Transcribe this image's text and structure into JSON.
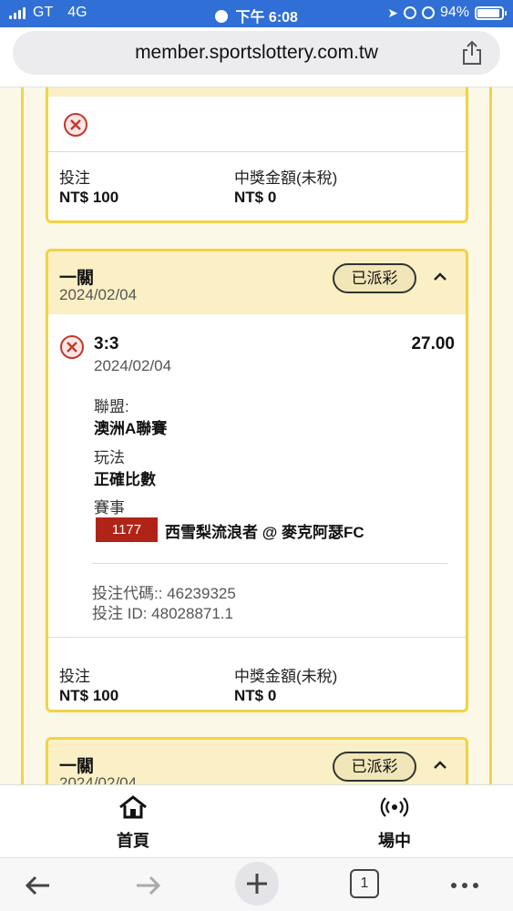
{
  "status_bar": {
    "carrier": "GT",
    "network": "4G",
    "time": "下午 6:08",
    "battery": "94%",
    "battery_level": 0.94
  },
  "browser": {
    "url": "member.sportslottery.com.tw",
    "tab_count": "1"
  },
  "bets": [
    {
      "stake_label": "投注",
      "stake_value": "NT$ 100",
      "payout_label": "中獎金額(未稅)",
      "payout_value": "NT$ 0"
    },
    {
      "type": "一關",
      "date": "2024/02/04",
      "status": "已派彩",
      "selection": {
        "score": "3:3",
        "odds": "27.00",
        "date": "2024/02/04",
        "league_label": "聯盟:",
        "league": "澳洲A聯賽",
        "market_label": "玩法",
        "market": "正確比數",
        "event_label": "賽事",
        "match_code": "1177",
        "match": "西雪梨流浪者 @ 麥克阿瑟FC"
      },
      "bet_code": "投注代碼:: 46239325",
      "bet_id": "投注 ID: 48028871.1",
      "stake_label": "投注",
      "stake_value": "NT$ 100",
      "payout_label": "中獎金額(未稅)",
      "payout_value": "NT$ 0"
    },
    {
      "type": "一關",
      "date": "2024/02/04",
      "status": "已派彩"
    }
  ],
  "bottom_nav": {
    "home": "首頁",
    "live": "場中"
  },
  "colors": {
    "accent_yellow": "#f2d343",
    "header_bg": "#fbf0c5",
    "lost_red": "#c0392b",
    "code_red": "#b02418",
    "status_blue": "#2f6fd6"
  }
}
